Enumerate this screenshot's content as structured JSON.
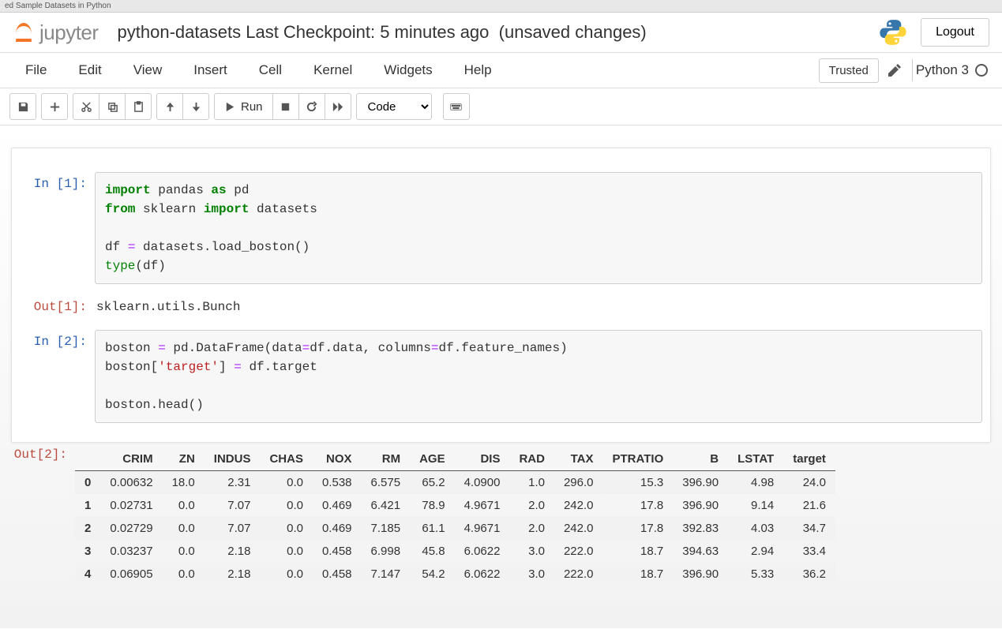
{
  "tab": "ed Sample Datasets in Python",
  "logo_text": "jupyter",
  "doc_title": "python-datasets",
  "checkpoint": "Last Checkpoint: 5 minutes ago",
  "unsaved": "(unsaved changes)",
  "logout": "Logout",
  "menus": [
    "File",
    "Edit",
    "View",
    "Insert",
    "Cell",
    "Kernel",
    "Widgets",
    "Help"
  ],
  "trusted": "Trusted",
  "kernel": "Python 3",
  "toolbar": {
    "run": "Run",
    "cell_type": "Code"
  },
  "cells": {
    "in1_prompt": "In [1]:",
    "in1_l1a": "import",
    "in1_l1b": " pandas ",
    "in1_l1c": "as",
    "in1_l1d": " pd",
    "in1_l2a": "from",
    "in1_l2b": " sklearn ",
    "in1_l2c": "import",
    "in1_l2d": " datasets",
    "in1_l3": "",
    "in1_l4a": "df ",
    "in1_l4b": "=",
    "in1_l4c": " datasets.load_boston()",
    "in1_l5a": "type",
    "in1_l5b": "(df)",
    "out1_prompt": "Out[1]:",
    "out1_text": "sklearn.utils.Bunch",
    "in2_prompt": "In [2]:",
    "in2_l1a": "boston ",
    "in2_l1b": "=",
    "in2_l1c": " pd.DataFrame(data",
    "in2_l1d": "=",
    "in2_l1e": "df.data, columns",
    "in2_l1f": "=",
    "in2_l1g": "df.feature_names)",
    "in2_l2a": "boston[",
    "in2_l2b": "'target'",
    "in2_l2c": "] ",
    "in2_l2d": "=",
    "in2_l2e": " df.target",
    "in2_l3": "",
    "in2_l4": "boston.head()",
    "out2_prompt": "Out[2]:"
  },
  "table": {
    "columns": [
      "CRIM",
      "ZN",
      "INDUS",
      "CHAS",
      "NOX",
      "RM",
      "AGE",
      "DIS",
      "RAD",
      "TAX",
      "PTRATIO",
      "B",
      "LSTAT",
      "target"
    ],
    "index": [
      "0",
      "1",
      "2",
      "3",
      "4"
    ],
    "rows": [
      [
        "0.00632",
        "18.0",
        "2.31",
        "0.0",
        "0.538",
        "6.575",
        "65.2",
        "4.0900",
        "1.0",
        "296.0",
        "15.3",
        "396.90",
        "4.98",
        "24.0"
      ],
      [
        "0.02731",
        "0.0",
        "7.07",
        "0.0",
        "0.469",
        "6.421",
        "78.9",
        "4.9671",
        "2.0",
        "242.0",
        "17.8",
        "396.90",
        "9.14",
        "21.6"
      ],
      [
        "0.02729",
        "0.0",
        "7.07",
        "0.0",
        "0.469",
        "7.185",
        "61.1",
        "4.9671",
        "2.0",
        "242.0",
        "17.8",
        "392.83",
        "4.03",
        "34.7"
      ],
      [
        "0.03237",
        "0.0",
        "2.18",
        "0.0",
        "0.458",
        "6.998",
        "45.8",
        "6.0622",
        "3.0",
        "222.0",
        "18.7",
        "394.63",
        "2.94",
        "33.4"
      ],
      [
        "0.06905",
        "0.0",
        "2.18",
        "0.0",
        "0.458",
        "7.147",
        "54.2",
        "6.0622",
        "3.0",
        "222.0",
        "18.7",
        "396.90",
        "5.33",
        "36.2"
      ]
    ]
  }
}
